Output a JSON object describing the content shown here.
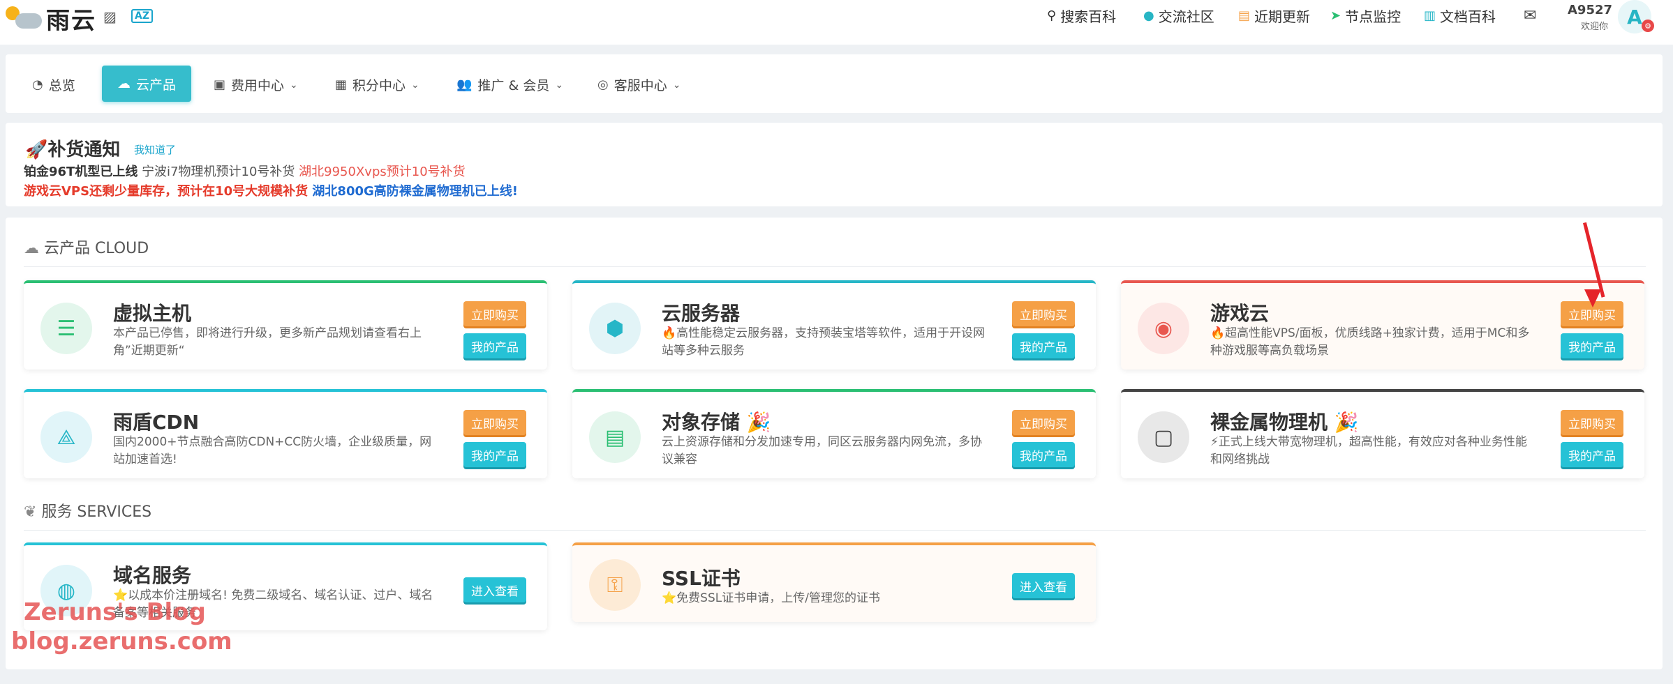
{
  "header": {
    "logo_text": "雨云",
    "nav": [
      {
        "icon": "search-icon",
        "glyph": "⚲",
        "label": "搜索百科"
      },
      {
        "icon": "qq-icon",
        "glyph": "●",
        "label": "交流社区"
      },
      {
        "icon": "news-icon",
        "glyph": "▤",
        "label": "近期更新"
      },
      {
        "icon": "location-arrow-icon",
        "glyph": "➤",
        "label": "节点监控"
      },
      {
        "icon": "book-icon",
        "glyph": "▥",
        "label": "文档百科"
      }
    ],
    "user_name": "A9527",
    "user_welcome": "欢迎你",
    "avatar_letter": "A",
    "translate_badge": "A"
  },
  "menu": {
    "items": [
      {
        "label": "总览",
        "glyph": "◔",
        "dropdown": false
      },
      {
        "label": "云产品",
        "glyph": "☁",
        "dropdown": false,
        "active": true
      },
      {
        "label": "费用中心",
        "glyph": "▣",
        "dropdown": true
      },
      {
        "label": "积分中心",
        "glyph": "▦",
        "dropdown": true
      },
      {
        "label": "推广 & 会员",
        "glyph": "👥",
        "dropdown": true
      },
      {
        "label": "客服中心",
        "glyph": "◎",
        "dropdown": true
      }
    ]
  },
  "notice": {
    "title": "🚀补货通知",
    "ack": "我知道了",
    "line1_a": "铂金96T机型已上线",
    "line1_b": "宁波i7物理机预计10号补货",
    "line1_c": "湖北9950Xvps预计10号补货",
    "line2_a": "游戏云VPS还剩少量库存，预计在10号大规模补货",
    "line2_b": "湖北800G高防裸金属物理机已上线!"
  },
  "cloud_section": {
    "title": "云产品 CLOUD",
    "cards": [
      {
        "title": "虚拟主机",
        "desc": "本产品已停售，即将进行升级，更多新产品规划请查看右上角”近期更新“",
        "buy": "立即购买",
        "mine": "我的产品",
        "color": "#2bbf73"
      },
      {
        "title": "云服务器",
        "desc": "🔥高性能稳定云服务器，支持预装宝塔等软件，适用于开设网站等多种云服务",
        "buy": "立即购买",
        "mine": "我的产品",
        "color": "#26b6c7"
      },
      {
        "title": "游戏云",
        "desc": "🔥超高性能VPS/面板，优质线路+独家计费，适用于MC和多种游戏服等高负载场景",
        "buy": "立即购买",
        "mine": "我的产品",
        "color": "#e8574f"
      },
      {
        "title": "雨盾CDN",
        "desc": "国内2000+节点融合高防CDN+CC防火墙，企业级质量，网站加速首选!",
        "buy": "立即购买",
        "mine": "我的产品",
        "color": "#26c2d6"
      },
      {
        "title": "对象存储 🎉",
        "desc": "云上资源存储和分发加速专用，同区云服务器内网免流，多协议兼容",
        "buy": "立即购买",
        "mine": "我的产品",
        "color": "#2bbf73"
      },
      {
        "title": "裸金属物理机 🎉",
        "desc": "⚡正式上线大带宽物理机，超高性能，有效应对各种业务性能和网络挑战",
        "buy": "立即购买",
        "mine": "我的产品",
        "color": "#444444"
      }
    ]
  },
  "services_section": {
    "title": "服务 SERVICES",
    "cards": [
      {
        "title": "域名服务",
        "desc": "⭐以成本价注册域名! 免费二级域名、域名认证、过户、域名备案等相关服务",
        "action": "进入查看",
        "color": "#26c2d6"
      },
      {
        "title": "SSL证书",
        "desc": "⭐免费SSL证书申请，上传/管理您的证书",
        "action": "进入查看",
        "color": "#f5a046"
      }
    ]
  },
  "watermark": {
    "line1": "Zeruns's Blog",
    "line2": "blog.zeruns.com"
  }
}
